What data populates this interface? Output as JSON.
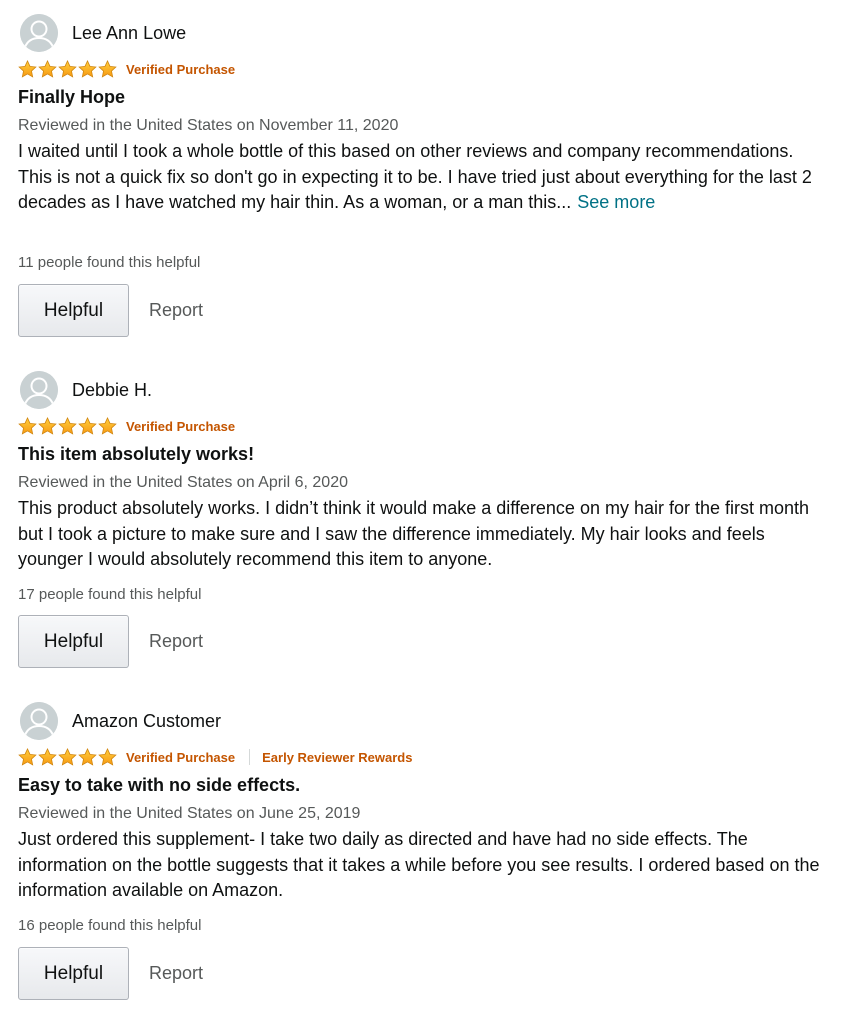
{
  "colors": {
    "star": "#ffa41c",
    "badge": "#c45500",
    "link": "#007185",
    "secondary_text": "#565959"
  },
  "reviews": [
    {
      "name": "Lee Ann Lowe",
      "rating": 5,
      "badge": "Verified Purchase",
      "title": "Finally Hope",
      "date": "Reviewed in the United States on November 11, 2020",
      "body": "I waited until I took a whole bottle of this based on other reviews and company recommendations. This is not a quick fix so don't go in expecting it to be. I have tried just about everything for the last 2 decades as I have watched my hair thin. As a woman, or a man this...",
      "see_more": "See more",
      "helpful_text": "11 people found this helpful",
      "helpful_button": "Helpful",
      "report": "Report"
    },
    {
      "name": "Debbie H.",
      "rating": 5,
      "badge": "Verified Purchase",
      "title": "This item absolutely works!",
      "date": "Reviewed in the United States on April 6, 2020",
      "body": "This product absolutely works. I didn’t think it would make a difference on my hair for the first month but I took a picture to make sure and I saw the difference immediately. My hair looks and feels younger I would absolutely recommend this item to anyone.",
      "helpful_text": "17 people found this helpful",
      "helpful_button": "Helpful",
      "report": "Report"
    },
    {
      "name": "Amazon Customer",
      "rating": 5,
      "badge": "Verified Purchase",
      "badge2": "Early Reviewer Rewards",
      "title": "Easy to take with no side effects.",
      "date": "Reviewed in the United States on June 25, 2019",
      "body": "Just ordered this supplement- I take two daily as directed and have had no side effects. The information on the bottle suggests that it takes a while before you see results. I ordered based on the information available on Amazon.",
      "helpful_text": "16 people found this helpful",
      "helpful_button": "Helpful",
      "report": "Report"
    }
  ]
}
